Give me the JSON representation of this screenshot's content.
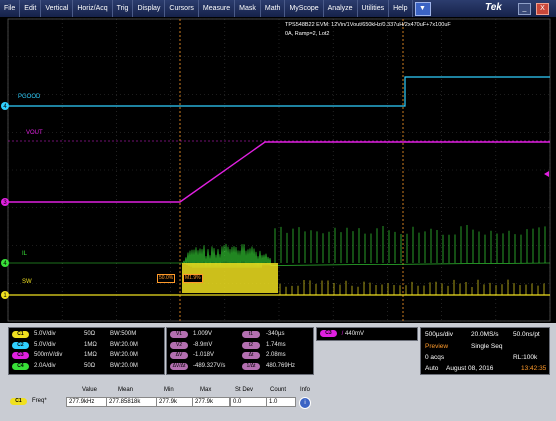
{
  "menu": [
    "File",
    "Edit",
    "Vertical",
    "Horiz/Acq",
    "Trig",
    "Display",
    "Cursors",
    "Measure",
    "Mask",
    "Math",
    "MyScope",
    "Analyze",
    "Utilities",
    "Help"
  ],
  "menu_dropdown_glyph": "▼",
  "brand": "Tek",
  "window_buttons": {
    "minimize": "_",
    "close": "X"
  },
  "waveform_info": {
    "line1": "TPS548B22 EVM: 12Vin/1Vout/650kHz/0.337uH/2x470uF+7x100uF",
    "line2": "0A, Ramp=2, Lot2"
  },
  "channels": [
    {
      "id": "4",
      "label": "PGOOD",
      "color": "#30d0ff"
    },
    {
      "id": "3",
      "label": "VOUT",
      "color": "#e020e0"
    },
    {
      "id": "4",
      "label": "IL",
      "color": "#38e038"
    },
    {
      "id": "1",
      "label": "SW",
      "color": "#f0e020"
    }
  ],
  "marker_left": "3",
  "cursor_tags": {
    "left": "50.0%",
    "right": "M1.9%"
  },
  "vertical": [
    {
      "tag": "C1",
      "scale": "5.0V/div",
      "imp": "50Ω",
      "bw": "BW:500M",
      "color": "#f0e020"
    },
    {
      "tag": "C2",
      "scale": "5.0V/div",
      "imp": "1MΩ",
      "bw": "BW:20.0M",
      "color": "#30d0ff"
    },
    {
      "tag": "C3",
      "scale": "500mV/div",
      "imp": "1MΩ",
      "bw": "BW:20.0M",
      "color": "#e020e0"
    },
    {
      "tag": "C4",
      "scale": "2.0A/div",
      "imp": "50Ω",
      "bw": "BW:20.0M",
      "color": "#38e038"
    }
  ],
  "cursors": {
    "left": [
      {
        "tag": "V1",
        "val": "1.009V"
      },
      {
        "tag": "V2",
        "val": "-8.9mV"
      },
      {
        "tag": "ΔV",
        "val": "-1.018V"
      },
      {
        "tag": "ΔV/Δt",
        "val": "-489.327V/s"
      }
    ],
    "right": [
      {
        "tag": "t1",
        "val": "-340µs"
      },
      {
        "tag": "t2",
        "val": "1.74ms"
      },
      {
        "tag": "Δt",
        "val": "2.08ms"
      },
      {
        "tag": "1/Δt",
        "val": "480.769Hz"
      }
    ]
  },
  "trigger": {
    "tag": "C3",
    "slope": "/",
    "level": "440mV"
  },
  "acquisition": {
    "timebase": "500µs/div",
    "rate": "20.0MS/s",
    "res": "50.0ns/pt",
    "mode": "Preview",
    "seq": "Single Seq",
    "acqs": "0 acqs",
    "rl": "RL:100k",
    "auto": "Auto",
    "date": "August 08, 2016",
    "time": "13:42:35"
  },
  "measurement": {
    "headers": [
      "Value",
      "Mean",
      "Min",
      "Max",
      "St Dev",
      "Count",
      "Info"
    ],
    "row": {
      "tag": "C1",
      "name": "Freq*",
      "value": "277.9kHz",
      "mean": "277.85818k",
      "min": "277.9k",
      "max": "277.9k",
      "stdev": "0.0",
      "count": "1.0"
    }
  }
}
